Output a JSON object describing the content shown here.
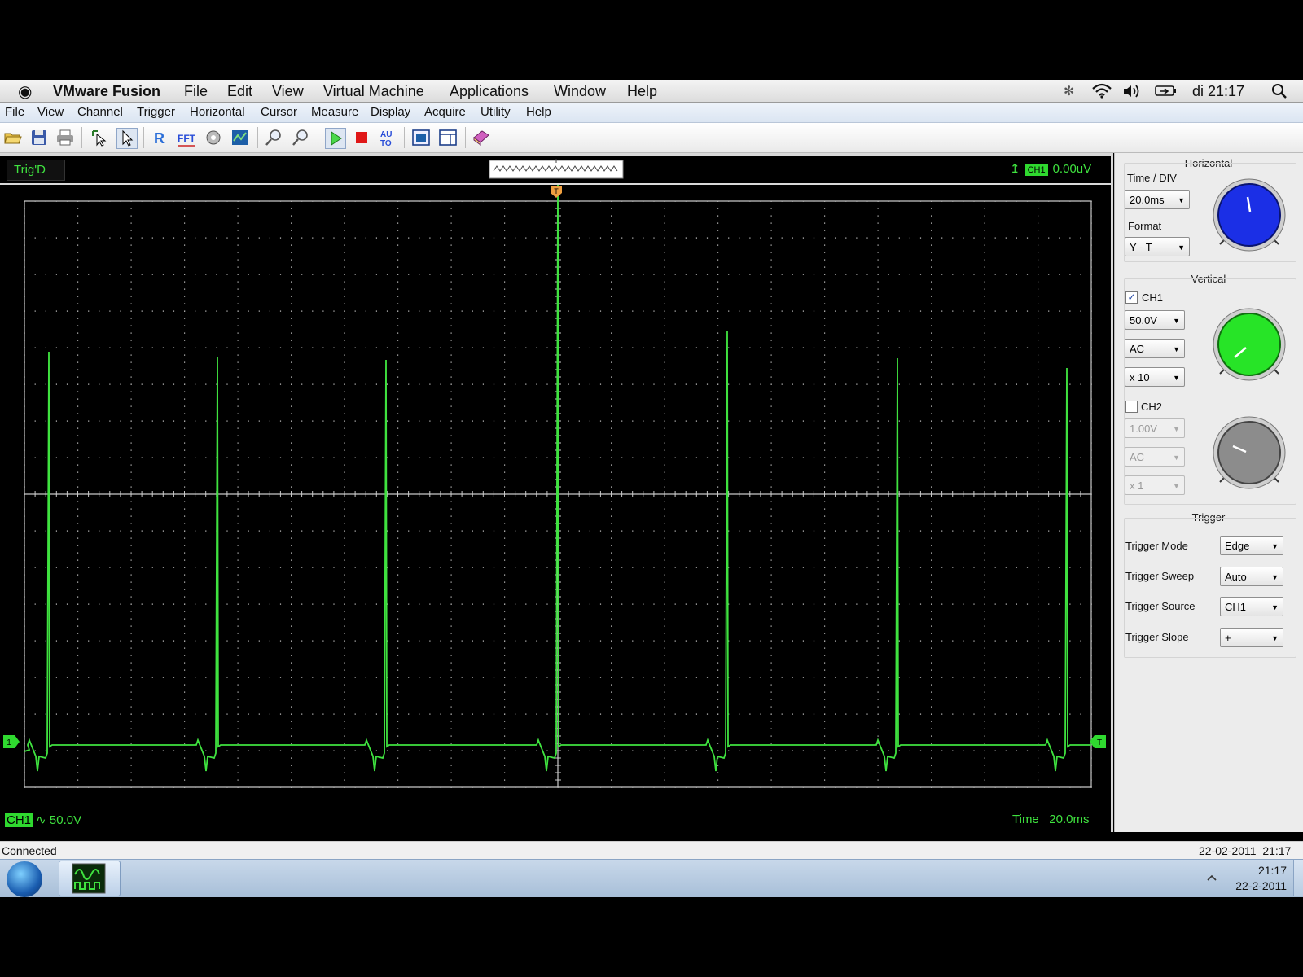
{
  "mac_menubar": {
    "app_name": "VMware Fusion",
    "menus": [
      "File",
      "Edit",
      "View",
      "Virtual Machine",
      "Applications",
      "Window",
      "Help"
    ],
    "clock": "di 21:17",
    "status_icons": [
      "vmware-status-icon",
      "wifi-icon",
      "volume-icon",
      "battery-icon",
      "spotlight-search-icon"
    ]
  },
  "app_menu": [
    "File",
    "View",
    "Channel",
    "Trigger",
    "Horizontal",
    "Cursor",
    "Measure",
    "Display",
    "Acquire",
    "Utility",
    "Help"
  ],
  "toolbar_icons": [
    "open-icon",
    "save-icon",
    "print-icon",
    "cursor-select-icon",
    "pointer-icon",
    "reference-icon",
    "fft-icon",
    "math-icon",
    "display-icon",
    "zoom-in-icon",
    "zoom-out-icon",
    "run-icon",
    "stop-icon",
    "auto-set-icon",
    "fit-icon",
    "window-icon",
    "book-icon"
  ],
  "scope": {
    "trig_status": "Trig'D",
    "trigger_channel": "CH1",
    "trigger_level": "0.00uV",
    "ch_scale_tag": "CH1",
    "ch_scale_value": "50.0V",
    "time_label": "Time",
    "time_value": "20.0ms",
    "trigger_marker": "T",
    "ch1_marker": "1",
    "level_marker": "T"
  },
  "panel": {
    "horizontal": {
      "title": "Horizontal",
      "time_div_label": "Time / DIV",
      "time_div_value": "20.0ms",
      "format_label": "Format",
      "format_value": "Y - T"
    },
    "vertical": {
      "title": "Vertical",
      "ch1": {
        "label": "CH1",
        "checked": true,
        "volts": "50.0V",
        "coupling": "AC",
        "probe": "x 10"
      },
      "ch2": {
        "label": "CH2",
        "checked": false,
        "volts": "1.00V",
        "coupling": "AC",
        "probe": "x 1"
      }
    },
    "trigger": {
      "title": "Trigger",
      "mode_label": "Trigger Mode",
      "mode_value": "Edge",
      "sweep_label": "Trigger Sweep",
      "sweep_value": "Auto",
      "source_label": "Trigger Source",
      "source_value": "CH1",
      "slope_label": "Trigger Slope",
      "slope_value": "+"
    }
  },
  "status_bar": {
    "left": "Connected",
    "right": "22-02-2011  21:17"
  },
  "taskbar": {
    "time": "21:17",
    "date": "22-2-2011"
  },
  "colors": {
    "trace": "#3fe23f",
    "grid": "#c8c8c8",
    "knob_horizontal": "#1b2fe6",
    "knob_ch1": "#27e427",
    "knob_ch2": "#8c8c8c"
  }
}
